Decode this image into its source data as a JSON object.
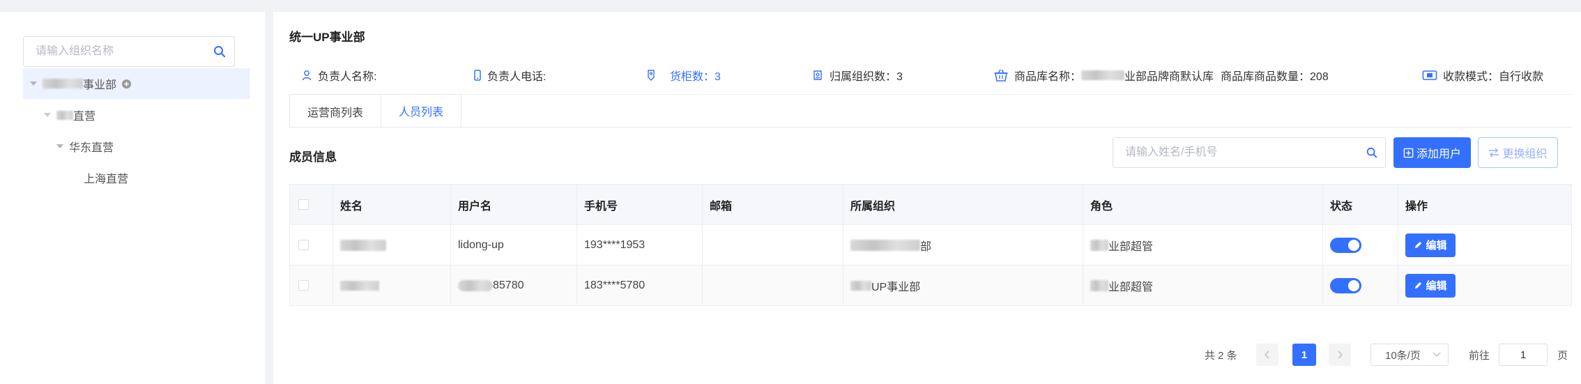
{
  "sidebar": {
    "search_placeholder": "请输入组织名称",
    "tree": [
      {
        "label_suffix": "事业部",
        "level": 0,
        "expanded": true,
        "active": true
      },
      {
        "label_suffix": "直营",
        "level": 1,
        "expanded": true
      },
      {
        "label": "华东直营",
        "level": 2,
        "expanded": true
      },
      {
        "label": "上海直营",
        "level": 3
      }
    ]
  },
  "main": {
    "title": "统一UP事业部",
    "info": {
      "owner_name_label": "负责人名称:",
      "owner_phone_label": "负责人电话:",
      "cabinet_count": "货柜数：3",
      "org_count": "归属组织数：3",
      "lib_name_label": "商品库名称：",
      "lib_name_suffix": "业部品牌商默认库",
      "lib_count": "商品库商品数量：208",
      "collect_mode": "收款模式：自行收款"
    },
    "tabs": [
      {
        "label": "运营商列表",
        "active": false
      },
      {
        "label": "人员列表",
        "active": true
      }
    ],
    "section_title": "成员信息",
    "member_search_placeholder": "请输入姓名/手机号",
    "add_user_label": "添加用户",
    "switch_org_label": "更换组织",
    "table": {
      "columns": [
        "姓名",
        "用户名",
        "手机号",
        "邮箱",
        "所属组织",
        "角色",
        "状态",
        "操作"
      ],
      "rows": [
        {
          "username": "lidong-up",
          "phone": "193****1953",
          "email": "",
          "org_suffix": "部",
          "role_suffix": "业部超管",
          "enabled": true,
          "action": "编辑"
        },
        {
          "username_suffix": "85780",
          "phone": "183****5780",
          "email": "",
          "org_suffix": "UP事业部",
          "role_suffix": "业部超管",
          "enabled": true,
          "action": "编辑"
        }
      ]
    },
    "pagination": {
      "total": "共 2 条",
      "current": "1",
      "page_size": "10条/页",
      "goto_label": "前往",
      "goto_value": "1",
      "page_unit": "页"
    }
  },
  "colors": {
    "primary": "#3370ff",
    "active_bg": "#ecf2fe"
  }
}
